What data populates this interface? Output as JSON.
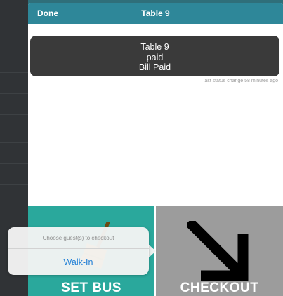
{
  "nav": {
    "done_label": "Done",
    "title": "Table 9"
  },
  "status_card": {
    "table": "Table 9",
    "payment_status": "paid",
    "bill_status": "Bill Paid"
  },
  "status_meta": "last status change 58 minutes ago",
  "actions": [
    {
      "label": "SET BUS",
      "icon": "broom-icon",
      "color": "#2aa89c"
    },
    {
      "label": "CHECKOUT",
      "icon": "arrow-down-right-icon",
      "color": "#9c9c9c"
    }
  ],
  "checkout_popover": {
    "title": "Choose guest(s) to checkout",
    "options": [
      "Walk-In"
    ]
  },
  "colors": {
    "nav": "#2e8799",
    "link": "#1f7fd6"
  }
}
